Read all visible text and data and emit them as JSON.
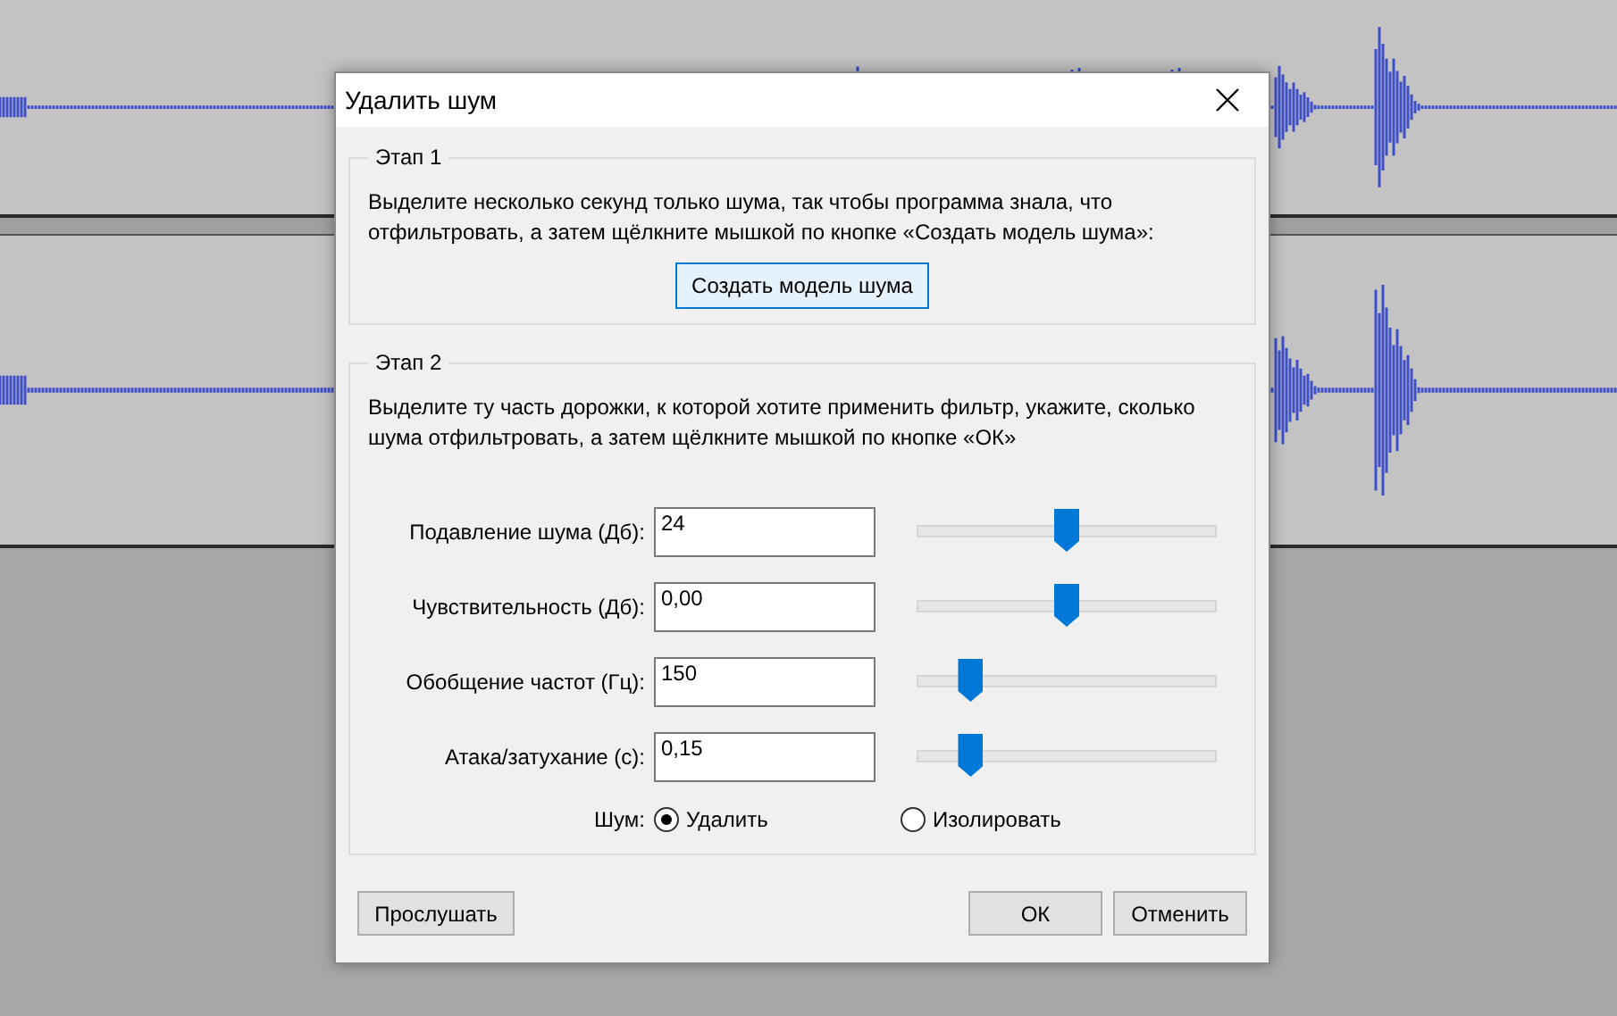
{
  "dialog": {
    "title": "Удалить шум",
    "step1": {
      "title": "Этап 1",
      "text": "Выделите несколько секунд только шума, так чтобы программа знала, что отфильтровать, а затем щёлкните мышкой по кнопке «Создать модель шума»:",
      "button": "Создать модель шума"
    },
    "step2": {
      "title": "Этап 2",
      "text": "Выделите ту часть дорожки, к которой хотите применить фильтр, укажите, сколько шума отфильтровать, а затем щёлкните мышкой по кнопке «ОК»",
      "params": [
        {
          "label": "Подавление шума (Дб):",
          "value": "24",
          "level": 0.5
        },
        {
          "label": "Чувствительность (Дб):",
          "value": "0,00",
          "level": 0.5
        },
        {
          "label": "Обобщение частот (Гц):",
          "value": "150",
          "level": 0.18
        },
        {
          "label": "Атака/затухание (с):",
          "value": "0,15",
          "level": 0.18
        }
      ],
      "noise_label": "Шум:",
      "noise_options": [
        {
          "label": "Удалить",
          "selected": true
        },
        {
          "label": "Изолировать",
          "selected": false
        }
      ]
    },
    "buttons": [
      {
        "label": "Прослушать",
        "kind": "left"
      },
      {
        "label": "ОК",
        "kind": "right"
      },
      {
        "label": "Отменить",
        "kind": "right"
      }
    ]
  }
}
